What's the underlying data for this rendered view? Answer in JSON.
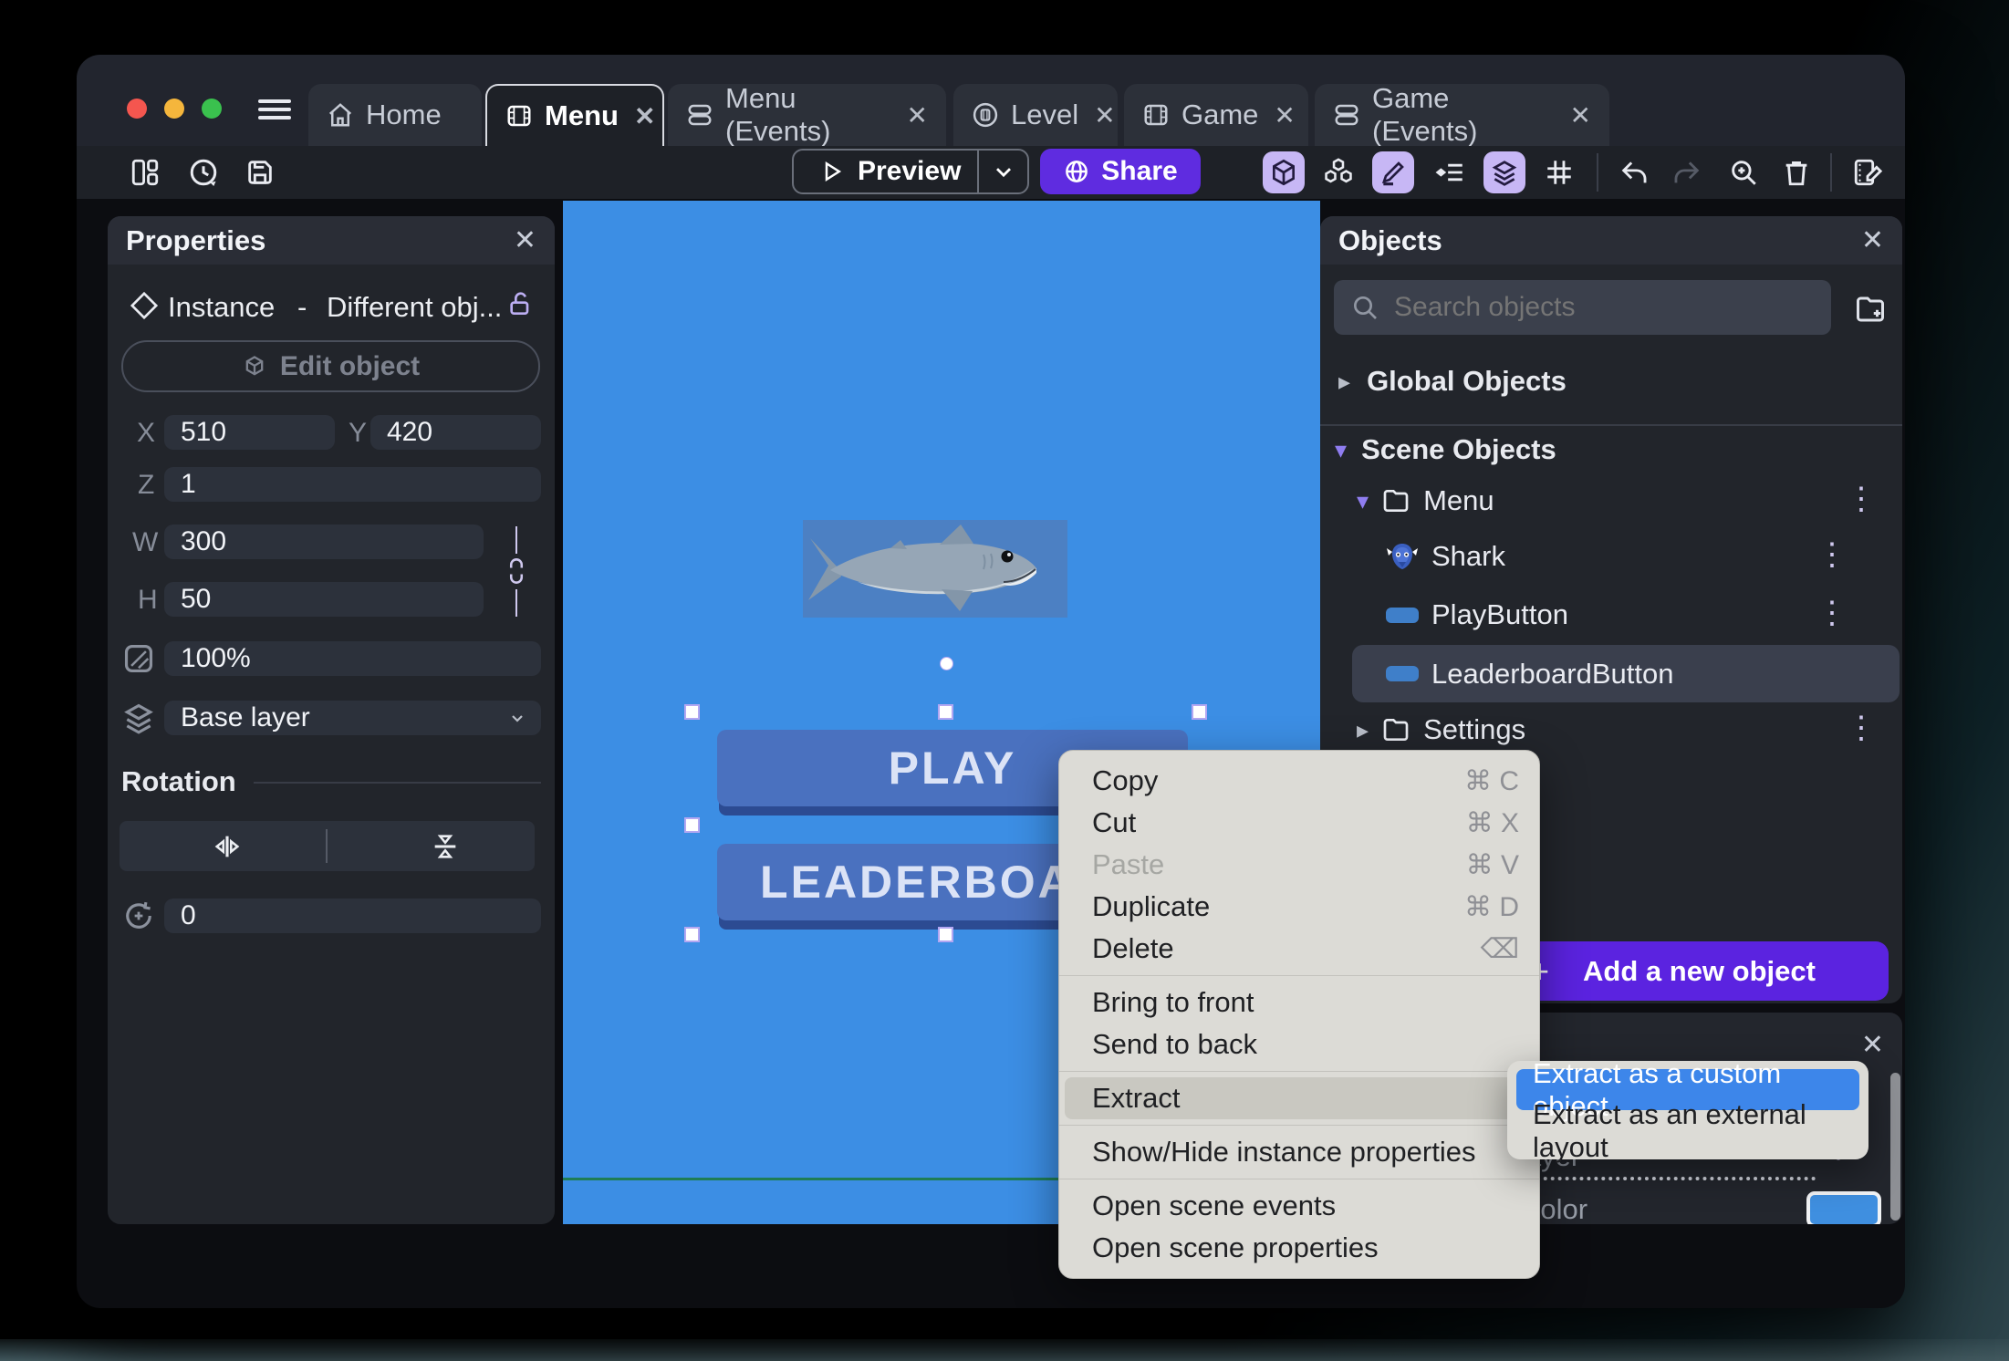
{
  "glyphs": {
    "close": "✕",
    "kebab": "⋮",
    "submenu_arrow": "›",
    "tri_right": "▸",
    "tri_down": "▾",
    "plus": "+"
  },
  "titlebar": {
    "tabs": [
      {
        "label": "Home"
      },
      {
        "label": "Menu"
      },
      {
        "label": "Menu (Events)"
      },
      {
        "label": "Level"
      },
      {
        "label": "Game"
      },
      {
        "label": "Game (Events)"
      }
    ]
  },
  "toolbar": {
    "preview_label": "Preview",
    "share_label": "Share"
  },
  "properties_panel": {
    "title": "Properties",
    "instance_type": "Instance",
    "separator": "-",
    "instance_object": "Different obj...",
    "edit_object_label": "Edit object",
    "labels": {
      "x": "X",
      "y": "Y",
      "z": "Z",
      "w": "W",
      "h": "H"
    },
    "values": {
      "x": "510",
      "y": "420",
      "z": "1",
      "w": "300",
      "h": "50",
      "opacity": "100%",
      "layer": "Base layer",
      "angle": "0"
    },
    "rotation_section_label": "Rotation"
  },
  "canvas": {
    "play_button_label": "PLAY",
    "leaderboard_button_label": "LEADERBOARD"
  },
  "objects_panel": {
    "title": "Objects",
    "search_placeholder": "Search objects",
    "global_section_label": "Global Objects",
    "scene_section_label": "Scene Objects",
    "tree": [
      {
        "label": "Menu"
      },
      {
        "label": "Shark"
      },
      {
        "label": "PlayButton"
      },
      {
        "label": "LeaderboardButton"
      },
      {
        "label": "Settings"
      }
    ],
    "add_object_label": "Add a new object"
  },
  "context_menu": {
    "items": [
      {
        "label": "Copy",
        "shortcut": "⌘ C"
      },
      {
        "label": "Cut",
        "shortcut": "⌘ X"
      },
      {
        "label": "Paste",
        "shortcut": "⌘ V"
      },
      {
        "label": "Duplicate",
        "shortcut": "⌘ D"
      },
      {
        "label": "Delete",
        "shortcut": "⌫"
      },
      {
        "label": "Bring to front"
      },
      {
        "label": "Send to back"
      },
      {
        "label": "Extract"
      },
      {
        "label": "Show/Hide instance properties"
      },
      {
        "label": "Open scene events"
      },
      {
        "label": "Open scene properties"
      }
    ]
  },
  "extract_submenu": {
    "items": [
      {
        "label": "Extract as a custom object"
      },
      {
        "label": "Extract as an external layout"
      }
    ]
  },
  "layers_panel": {
    "layer_row_fragment": "layer",
    "color_row_fragment": "d color",
    "swatch_color": "#3f8fe0"
  }
}
